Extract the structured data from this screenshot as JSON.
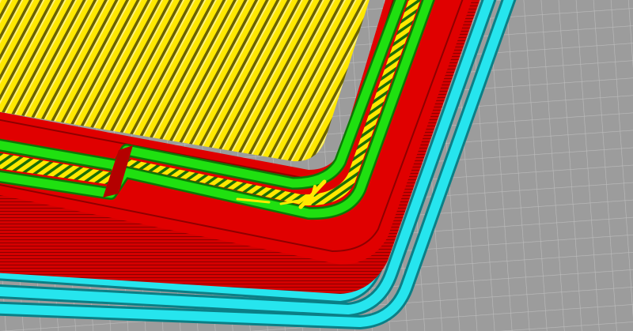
{
  "viewer": {
    "caption": ""
  },
  "colors": {
    "background_grey": "#9a9a9a",
    "grid_line": "#b8b8b8",
    "skirt_cyan": "#26e5ee",
    "skirt_shadow": "#0a7f86",
    "wall_red": "#e00000",
    "wall_red_shade": "#8e0000",
    "inner_wall_green": "#1fe010",
    "inner_wall_shade": "#0a7a05",
    "infill_yellow": "#ffe800",
    "infill_shade": "#8a7f00"
  },
  "features": [
    {
      "name": "build-plate-grid",
      "color_key": "grid_line"
    },
    {
      "name": "skirt",
      "color_key": "skirt_cyan"
    },
    {
      "name": "outer-wall",
      "color_key": "wall_red"
    },
    {
      "name": "inner-wall",
      "color_key": "inner_wall_green"
    },
    {
      "name": "top-skin-infill",
      "color_key": "infill_yellow"
    },
    {
      "name": "gap-fill",
      "color_key": "infill_yellow"
    }
  ]
}
